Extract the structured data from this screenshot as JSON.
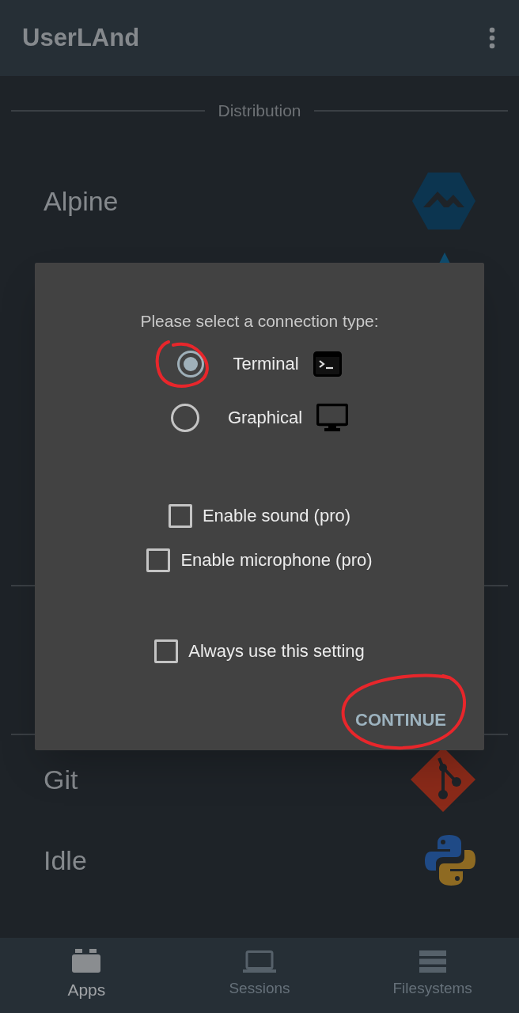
{
  "app_bar": {
    "title": "UserLAnd"
  },
  "section_header": "Distribution",
  "distributions": [
    {
      "label": "Alpine"
    }
  ],
  "apps": [
    {
      "label": "Git"
    },
    {
      "label": "Idle"
    }
  ],
  "dialog": {
    "prompt": "Please select a connection type:",
    "connection_types": [
      {
        "label": "Terminal",
        "selected": true
      },
      {
        "label": "Graphical",
        "selected": false
      }
    ],
    "options": [
      {
        "label": "Enable sound (pro)",
        "checked": false
      },
      {
        "label": "Enable microphone (pro)",
        "checked": false
      }
    ],
    "always_option": {
      "label": "Always use this setting",
      "checked": false
    },
    "button": "CONTINUE"
  },
  "bottom_nav": [
    {
      "label": "Apps",
      "selected": true
    },
    {
      "label": "Sessions",
      "selected": false
    },
    {
      "label": "Filesystems",
      "selected": false
    }
  ]
}
